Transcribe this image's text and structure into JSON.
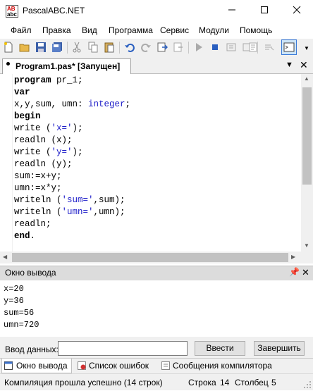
{
  "window": {
    "title": "PascalABC.NET",
    "icon_text": "AB\nabc"
  },
  "menu": [
    "Файл",
    "Правка",
    "Вид",
    "Программа",
    "Сервис",
    "Модули",
    "Помощь"
  ],
  "toolbar": {
    "icons": [
      "new-file-icon",
      "open-folder-icon",
      "save-icon",
      "save-all-icon",
      "cut-icon",
      "copy-icon",
      "paste-icon",
      "undo-icon",
      "redo-icon",
      "compile-icon",
      "debug-icon",
      "run-icon",
      "stop-icon",
      "step-into-icon",
      "step-over-icon",
      "comment-icon",
      "uncomment-icon",
      "output-window-icon"
    ]
  },
  "editor": {
    "tab_label": "Program1.pas* [Запущен]",
    "lines": [
      "program pr_1;",
      "var",
      "x,y,sum, umn: integer;",
      "begin",
      "write ('x=');",
      "readln (x);",
      "write ('y=');",
      "readln (y);",
      "sum:=x+y;",
      "umn:=x*y;",
      "writeln ('sum=',sum);",
      "writeln ('umn=',umn);",
      "readln;",
      "end."
    ]
  },
  "output": {
    "title": "Окно вывода",
    "lines": [
      "x=20",
      "y=36",
      "sum=56",
      "umn=720"
    ]
  },
  "input": {
    "label": "Ввод данных:",
    "value": "",
    "enter_label": "Ввести",
    "finish_label": "Завершить"
  },
  "bottom_tabs": [
    "Окно вывода",
    "Список ошибок",
    "Сообщения компилятора"
  ],
  "status": {
    "message": "Компиляция прошла успешно (14 строк)",
    "row_label": "Строка",
    "row_value": "14",
    "col_label": "Столбец",
    "col_value": "5"
  }
}
